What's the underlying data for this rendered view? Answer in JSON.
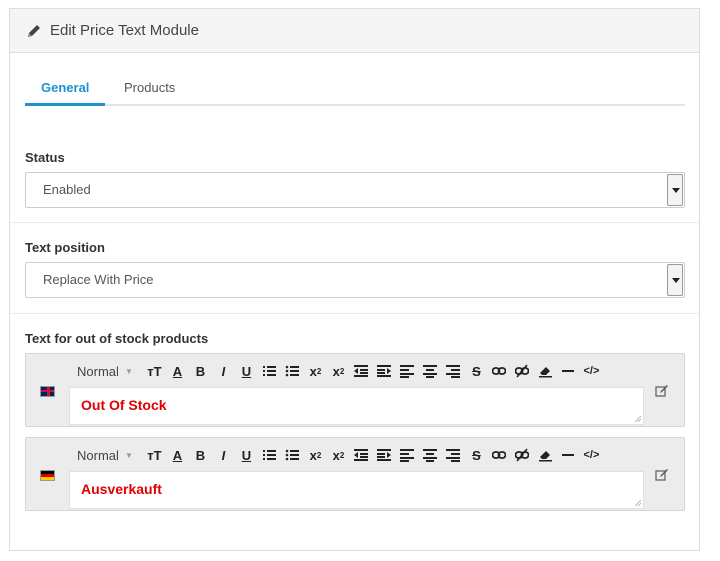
{
  "panel": {
    "title": "Edit Price Text Module"
  },
  "tabs": [
    {
      "label": "General",
      "active": true
    },
    {
      "label": "Products",
      "active": false
    }
  ],
  "status": {
    "label": "Status",
    "value": "Enabled"
  },
  "text_position": {
    "label": "Text position",
    "value": "Replace With Price"
  },
  "out_of_stock": {
    "label": "Text for out of stock products",
    "editors": [
      {
        "language": "English",
        "flag_icon": "uk-flag-icon",
        "text": "Out Of Stock"
      },
      {
        "language": "German",
        "flag_icon": "de-flag-icon",
        "text": "Ausverkauft"
      }
    ]
  },
  "toolbar": {
    "format_label": "Normal",
    "buttons": [
      "font-size",
      "font-color",
      "bold",
      "italic",
      "underline",
      "ordered-list",
      "unordered-list",
      "subscript",
      "superscript",
      "outdent",
      "indent",
      "align-left",
      "align-center",
      "align-right",
      "strikethrough",
      "link",
      "unlink",
      "clear-format",
      "horizontal-rule",
      "code-view"
    ]
  },
  "colors": {
    "accent": "#1e91cf",
    "editor_text": "#e00000",
    "panel_head": "#f5f5f5"
  }
}
